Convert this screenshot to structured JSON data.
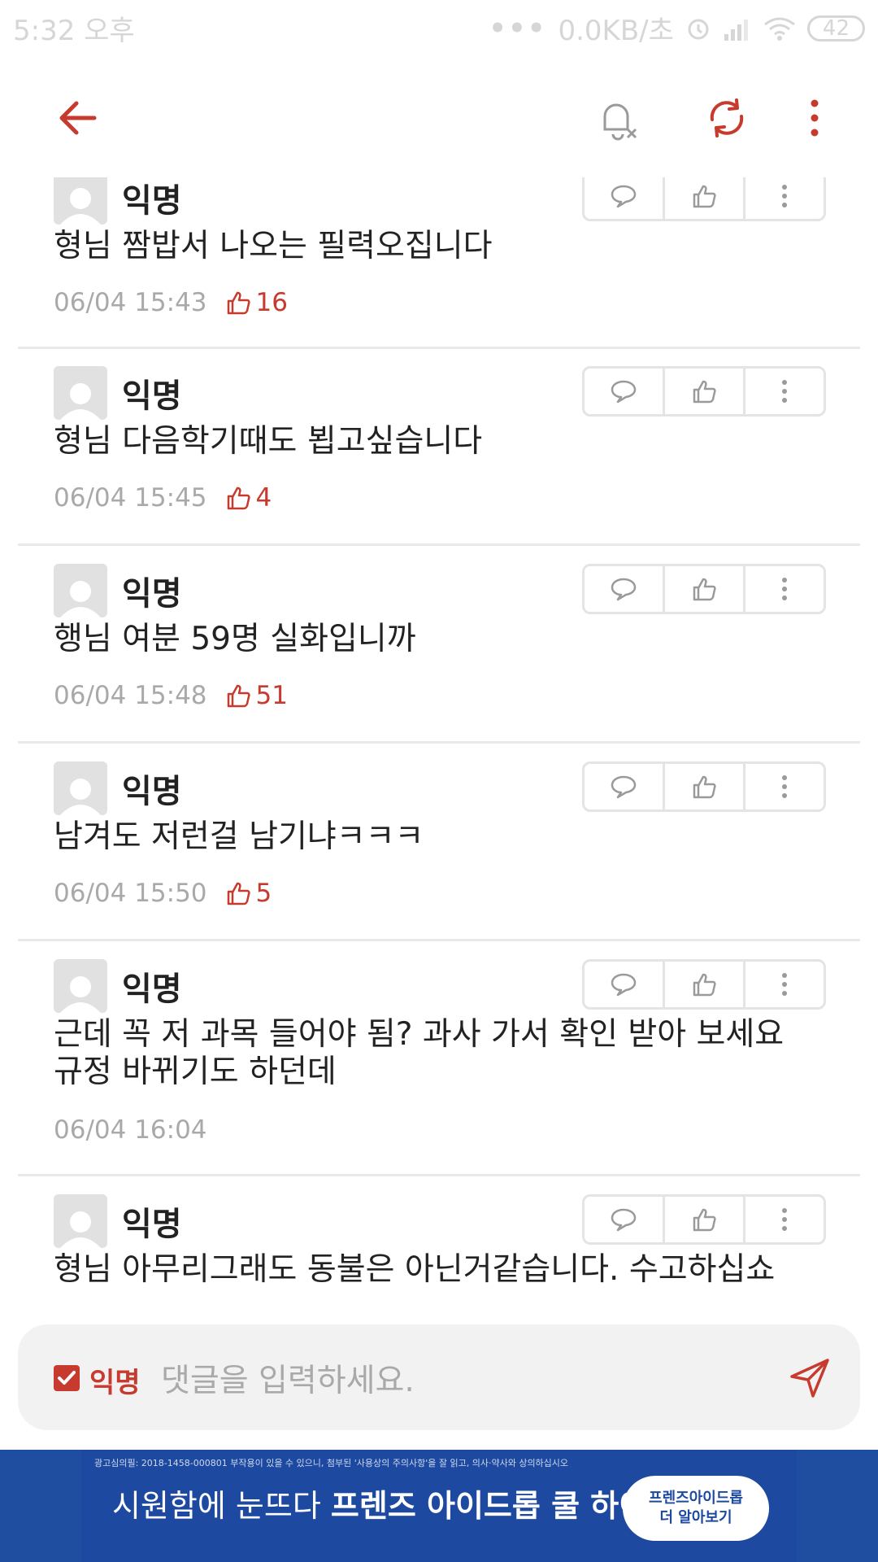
{
  "status": {
    "time": "5:32 오후",
    "dots": "•••",
    "speed": "0.0KB/초",
    "battery": "42"
  },
  "topbar": {
    "back_icon": "arrow-left-icon",
    "mute_icon": "bell-off-icon",
    "refresh_icon": "refresh-icon",
    "menu_icon": "more-vert-icon"
  },
  "colors": {
    "accent": "#c73a2e",
    "divider": "#e9e9e9",
    "muted": "#a9a9a9",
    "ad_blue": "#1d4aa0"
  },
  "comments": [
    {
      "author": "익명",
      "text": "형님 짬밥서 나오는 필력오집니다",
      "time": "06/04 15:43",
      "likes": "16"
    },
    {
      "author": "익명",
      "text": "형님 다음학기때도 뵙고싶습니다",
      "time": "06/04 15:45",
      "likes": "4"
    },
    {
      "author": "익명",
      "text": "행님 여분 59명 실화입니까",
      "time": "06/04 15:48",
      "likes": "51"
    },
    {
      "author": "익명",
      "text": "남겨도 저런걸 남기냐ㅋㅋㅋ",
      "time": "06/04 15:50",
      "likes": "5"
    },
    {
      "author": "익명",
      "text": "근데 꼭 저 과목 들어야 됨? 과사 가서 확인 받아 보세요 규정 바뀌기도 하던데",
      "time": "06/04 16:04",
      "likes": ""
    },
    {
      "author": "익명",
      "text": "형님 아무리그래도 동불은 아닌거같습니다. 수고하십쇼",
      "time": "",
      "likes": ""
    }
  ],
  "input": {
    "anon_label": "익명",
    "placeholder": "댓글을 입력하세요.",
    "send_icon": "send-icon"
  },
  "ad": {
    "notice": "광고심의필: 2018-1458-000801 부작용이 있을 수 있으니, 첨부된 '사용상의 주의사항'을 잘 읽고, 의사·약사와 상의하십시오",
    "headline_prefix": "시원함에 눈뜨다",
    "headline_bold": "프렌즈 아이드롭 쿨 하이",
    "cta_line1": "프렌즈아이드롭",
    "cta_line2": "더 알아보기"
  }
}
